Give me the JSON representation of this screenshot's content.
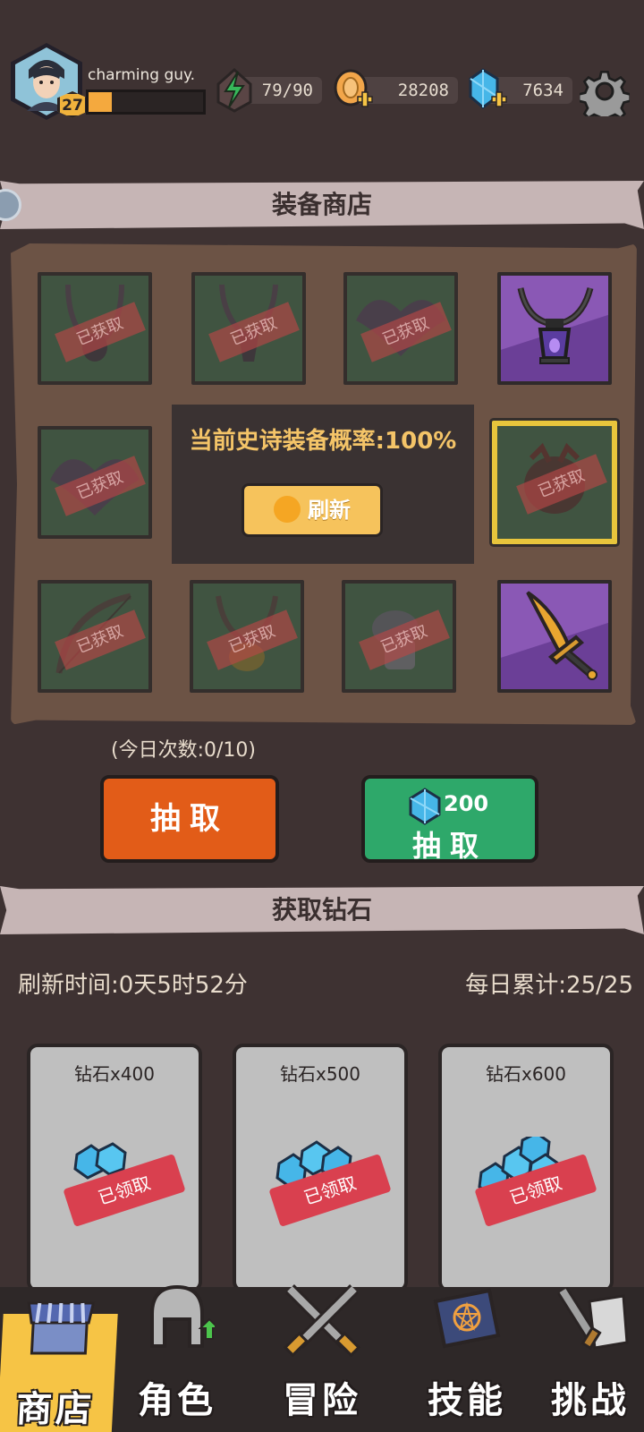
{
  "player": {
    "name": "charming guy.",
    "level": "27",
    "xp_fraction": 0.2
  },
  "resources": {
    "energy": "79/90",
    "gold": "28208",
    "gems": "7634"
  },
  "shop": {
    "title": "装备商店",
    "owned_stamp": "已获取",
    "epic_rate": "当前史诗装备概率:100%",
    "refresh_label": "刷新",
    "today_count": "(今日次数:0/10)",
    "draw_label": "抽取",
    "gem_draw": {
      "cost": "200",
      "label": "抽取"
    }
  },
  "diamonds": {
    "title": "获取钻石",
    "refresh_time": "刷新时间:0天5时52分",
    "daily_total": "每日累计:25/25",
    "claimed_stamp": "已领取",
    "cards": [
      {
        "title": "钻石x400"
      },
      {
        "title": "钻石x500"
      },
      {
        "title": "钻石x600"
      }
    ]
  },
  "nav": {
    "items": [
      {
        "label": "商店",
        "icon": "shop-icon",
        "active": true
      },
      {
        "label": "角色",
        "icon": "helmet-icon"
      },
      {
        "label": "冒险",
        "icon": "crossed-swords-icon"
      },
      {
        "label": "技能",
        "icon": "spellbook-icon"
      },
      {
        "label": "挑战",
        "icon": "sword-scroll-icon"
      }
    ]
  },
  "colors": {
    "accent_orange": "#e25c18",
    "accent_green": "#2ea86a",
    "gold": "#f6c445",
    "epic_purple": "#8a58b5"
  }
}
